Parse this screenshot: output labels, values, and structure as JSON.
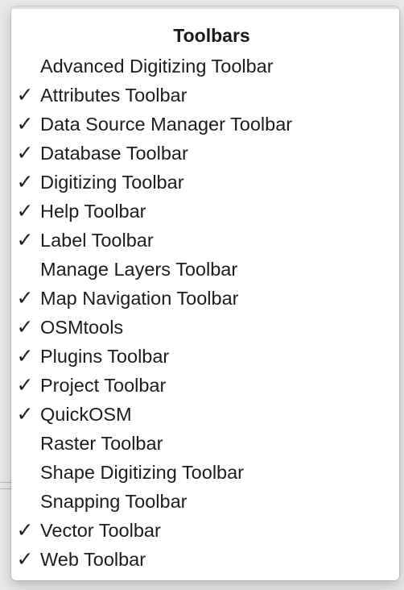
{
  "menu": {
    "title": "Toolbars",
    "items": [
      {
        "label": "Advanced Digitizing Toolbar",
        "checked": false,
        "check_glyph": ""
      },
      {
        "label": "Attributes Toolbar",
        "checked": true,
        "check_glyph": "✓"
      },
      {
        "label": "Data Source Manager Toolbar",
        "checked": true,
        "check_glyph": "✓"
      },
      {
        "label": "Database Toolbar",
        "checked": true,
        "check_glyph": "✓"
      },
      {
        "label": "Digitizing Toolbar",
        "checked": true,
        "check_glyph": "✓"
      },
      {
        "label": "Help Toolbar",
        "checked": true,
        "check_glyph": "✓"
      },
      {
        "label": "Label Toolbar",
        "checked": true,
        "check_glyph": "✓"
      },
      {
        "label": "Manage Layers Toolbar",
        "checked": false,
        "check_glyph": ""
      },
      {
        "label": "Map Navigation Toolbar",
        "checked": true,
        "check_glyph": "✓"
      },
      {
        "label": "OSMtools",
        "checked": true,
        "check_glyph": "✓"
      },
      {
        "label": "Plugins Toolbar",
        "checked": true,
        "check_glyph": "✓"
      },
      {
        "label": "Project Toolbar",
        "checked": true,
        "check_glyph": "✓"
      },
      {
        "label": "QuickOSM",
        "checked": true,
        "check_glyph": "✓"
      },
      {
        "label": "Raster Toolbar",
        "checked": false,
        "check_glyph": ""
      },
      {
        "label": "Shape Digitizing Toolbar",
        "checked": false,
        "check_glyph": ""
      },
      {
        "label": "Snapping Toolbar",
        "checked": false,
        "check_glyph": ""
      },
      {
        "label": "Vector Toolbar",
        "checked": true,
        "check_glyph": "✓"
      },
      {
        "label": "Web Toolbar",
        "checked": true,
        "check_glyph": "✓"
      }
    ]
  },
  "colors": {
    "menu_background": "#ffffff",
    "text": "#1c1c1c",
    "backdrop": "#e9e9e9"
  }
}
